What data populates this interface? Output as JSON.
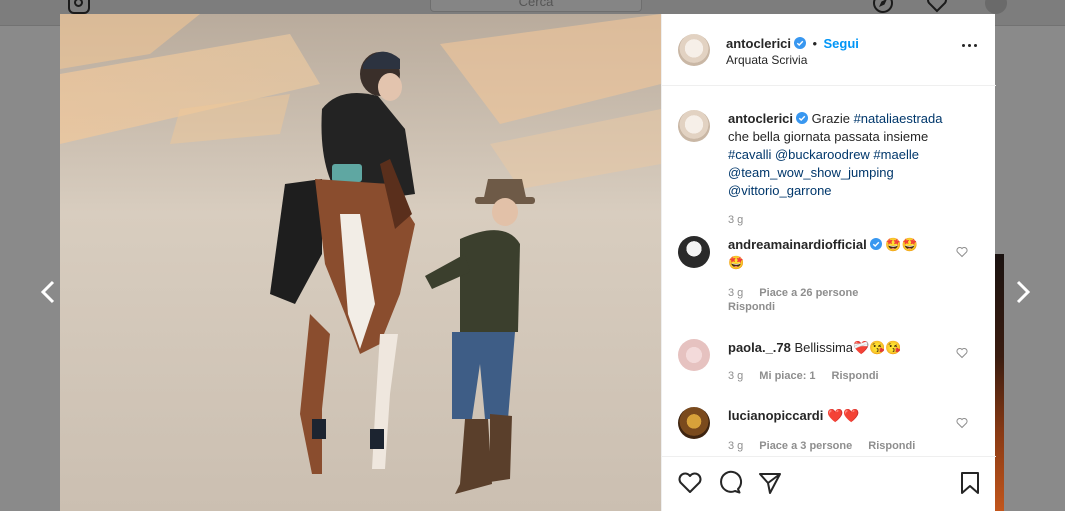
{
  "topbar": {
    "search_placeholder": "Cerca"
  },
  "post": {
    "owner": "antoclerici",
    "follow_label": "Segui",
    "separator": "•",
    "location": "Arquata Scrivia"
  },
  "caption": {
    "user": "antoclerici",
    "lines": [
      {
        "plain": "Grazie ",
        "tag": "#nataliaestrada"
      },
      {
        "plain": "che bella giornata passata insieme",
        "tag": ""
      },
      {
        "plain": "",
        "tag": "#cavalli @buckaroodrew #maelle"
      },
      {
        "plain": "",
        "tag": "@team_wow_show_jumping"
      },
      {
        "plain": "",
        "tag": "@vittorio_garrone"
      }
    ],
    "time": "3 g"
  },
  "comments": [
    {
      "user": "andreamainardiofficial",
      "text": "🤩🤩",
      "text2": "🤩",
      "time": "3 g",
      "likes": "Piace a 26 persone",
      "reply": "Rispondi"
    },
    {
      "user": "paola._.78",
      "text": "Bellissima❤️‍🩹😘😘",
      "time": "3 g",
      "likes": "Mi piace: 1",
      "reply": "Rispondi"
    },
    {
      "user": "lucianopiccardi",
      "text": "❤️❤️",
      "time": "3 g",
      "likes": "Piace a 3 persone",
      "reply": "Rispondi"
    }
  ],
  "colors": {
    "link": "#0095f6",
    "hashtag": "#00376b",
    "meta": "#8e8e8e",
    "verified": "#3897f0"
  },
  "icons": [
    "heart-icon",
    "comment-icon",
    "share-icon",
    "bookmark-icon",
    "more-options-icon",
    "verified-badge-icon",
    "chevron-left-icon",
    "chevron-right-icon"
  ]
}
